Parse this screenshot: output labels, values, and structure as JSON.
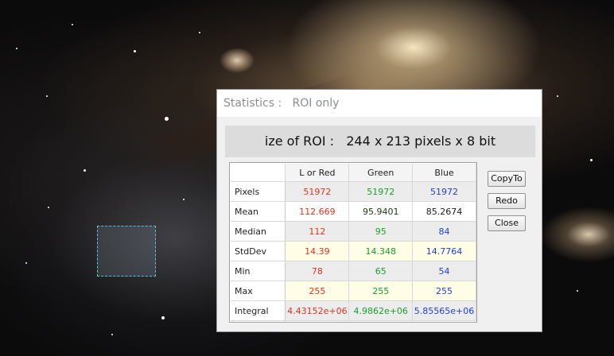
{
  "dialog": {
    "title": "Statistics :   ROI only",
    "roi_size": "ize of ROI :   244 x 213 pixels x 8 bit"
  },
  "table": {
    "columns": [
      "L or Red",
      "Green",
      "Blue"
    ],
    "rows": [
      {
        "label": "Pixels",
        "values": [
          "51972",
          "51972",
          "51972"
        ]
      },
      {
        "label": "Mean",
        "values": [
          "112.669",
          "95.9401",
          "85.2674"
        ]
      },
      {
        "label": "Median",
        "values": [
          "112",
          "95",
          "84"
        ]
      },
      {
        "label": "StdDev",
        "values": [
          "14.39",
          "14.348",
          "14.7764"
        ]
      },
      {
        "label": "Min",
        "values": [
          "78",
          "65",
          "54"
        ]
      },
      {
        "label": "Max",
        "values": [
          "255",
          "255",
          "255"
        ]
      },
      {
        "label": "Integral",
        "values": [
          "4.43152e+06",
          "4.9862e+06",
          "5.85565e+06"
        ]
      }
    ]
  },
  "buttons": {
    "copy_to": "CopyTo",
    "redo": "Redo",
    "close": "Close"
  },
  "colors": {
    "red_channel": "#e53020",
    "green_channel": "#1a9e2c",
    "blue_channel": "#1f3fe0",
    "highlight": "#ffee00",
    "roi_outline": "#4fc3e6"
  }
}
